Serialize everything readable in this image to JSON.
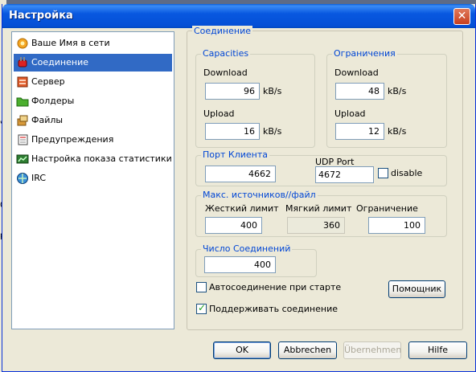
{
  "window": {
    "title": "Настройка",
    "close_glyph": "✕"
  },
  "sidebar": {
    "items": [
      {
        "label": "Ваше Имя в сети",
        "icon": "sun-gear-icon",
        "selected": false
      },
      {
        "label": "Соединение",
        "icon": "plug-icon",
        "selected": true
      },
      {
        "label": "Сервер",
        "icon": "server-icon",
        "selected": false
      },
      {
        "label": "Фолдеры",
        "icon": "folder-icon",
        "selected": false
      },
      {
        "label": "Файлы",
        "icon": "files-icon",
        "selected": false
      },
      {
        "label": "Предупреждения",
        "icon": "notebook-icon",
        "selected": false
      },
      {
        "label": "Настройка показа статистики",
        "icon": "chart-icon",
        "selected": false
      },
      {
        "label": "IRC",
        "icon": "irc-icon",
        "selected": false
      }
    ]
  },
  "panel": {
    "title": "Соединение",
    "capacities": {
      "title": "Capacities",
      "download_label": "Download",
      "download_value": "96",
      "download_unit": "kB/s",
      "upload_label": "Upload",
      "upload_value": "16",
      "upload_unit": "kB/s"
    },
    "limits": {
      "title": "Ограничения",
      "download_label": "Download",
      "download_value": "48",
      "download_unit": "kB/s",
      "upload_label": "Upload",
      "upload_value": "12",
      "upload_unit": "kB/s"
    },
    "client_port": {
      "title": "Порт Клиента",
      "port_value": "4662",
      "udp_label": "UDP Port",
      "udp_value": "4672",
      "disable_label": "disable",
      "disable_checked": false
    },
    "max_sources": {
      "title": "Макс. источников//файл",
      "hard_label": "Жесткий лимит",
      "hard_value": "400",
      "soft_label": "Мягкий лимит",
      "soft_value": "360",
      "limit_label": "Ограничение",
      "limit_value": "100"
    },
    "connections": {
      "title": "Число Соединений",
      "value": "400"
    },
    "autoconnect": {
      "label": "Автосоединение при старте",
      "checked": false
    },
    "keepalive": {
      "label": "Поддерживать соединение",
      "checked": true
    },
    "wizard_button": "Помощник"
  },
  "buttons": {
    "ok": "OK",
    "cancel": "Abbrechen",
    "apply": "Übernehmen",
    "help": "Hilfe"
  },
  "background": {
    "chars": [
      "ч",
      "0s",
      "p"
    ]
  },
  "colors": {
    "selection": "#316ac5",
    "group_title": "#0046d5",
    "titlebar": "#0858e0"
  }
}
